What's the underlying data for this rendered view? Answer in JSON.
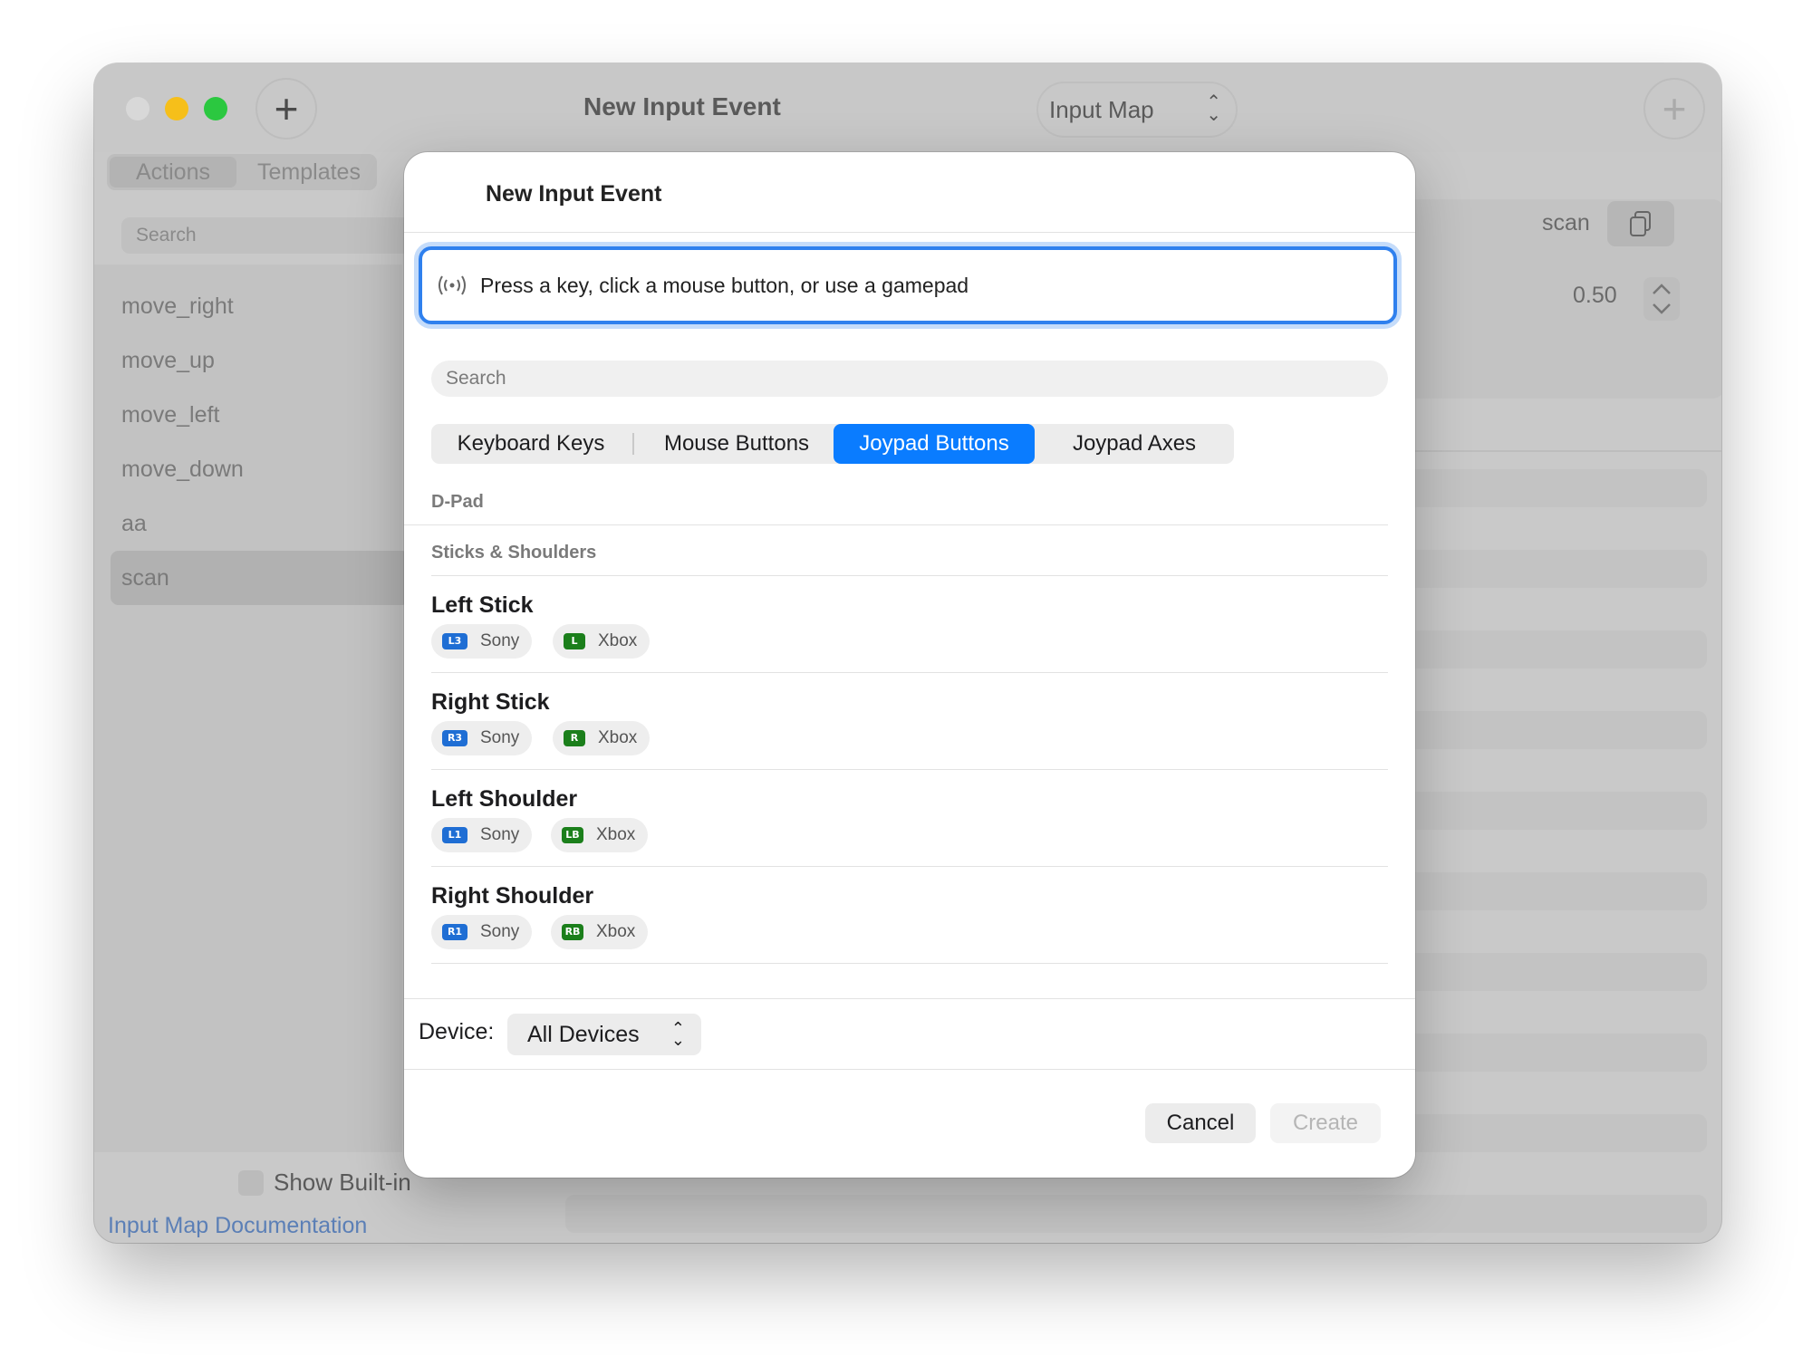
{
  "window": {
    "title": "New Input Event",
    "input_map_select": "Input Map",
    "add_symbol": "+"
  },
  "sidebar": {
    "tabs": [
      "Actions",
      "Templates"
    ],
    "search_placeholder": "Search",
    "items": [
      {
        "label": "move_right"
      },
      {
        "label": "move_up"
      },
      {
        "label": "move_left"
      },
      {
        "label": "move_down"
      },
      {
        "label": "aa"
      },
      {
        "label": "scan"
      }
    ],
    "show_builtin_label": "Show Built-in",
    "doc_link": "Input Map Documentation"
  },
  "detail": {
    "action_name": "scan",
    "deadzone": "0.50"
  },
  "dialog": {
    "title": "New Input Event",
    "capture_prompt": "Press a key, click a mouse button, or use a gamepad",
    "search_placeholder": "Search",
    "tabs": [
      {
        "label": "Keyboard Keys",
        "active": false
      },
      {
        "label": "Mouse Buttons",
        "active": false
      },
      {
        "label": "Joypad Buttons",
        "active": true
      },
      {
        "label": "Joypad Axes",
        "active": false
      }
    ],
    "groups": [
      {
        "label": "D-Pad"
      },
      {
        "label": "Sticks & Shoulders"
      }
    ],
    "items": [
      {
        "title": "Left Stick",
        "sony_badge": "L3",
        "sony": "Sony",
        "xbox_badge": "L",
        "xbox": "Xbox"
      },
      {
        "title": "Right Stick",
        "sony_badge": "R3",
        "sony": "Sony",
        "xbox_badge": "R",
        "xbox": "Xbox"
      },
      {
        "title": "Left Shoulder",
        "sony_badge": "L1",
        "sony": "Sony",
        "xbox_badge": "LB",
        "xbox": "Xbox"
      },
      {
        "title": "Right Shoulder",
        "sony_badge": "R1",
        "sony": "Sony",
        "xbox_badge": "RB",
        "xbox": "Xbox"
      }
    ],
    "device_label": "Device:",
    "device_value": "All Devices",
    "cancel_label": "Cancel",
    "create_label": "Create"
  },
  "colors": {
    "accent": "#0a7cff",
    "sony_badge": "#1f6ed4",
    "xbox_badge": "#1b7f1b",
    "traffic_min": "#f6bf1a",
    "traffic_max": "#2bc840"
  },
  "icons": [
    "plus-icon",
    "chevron-updown-icon",
    "copy-icon",
    "signal-wave-icon",
    "stepper-icon"
  ]
}
